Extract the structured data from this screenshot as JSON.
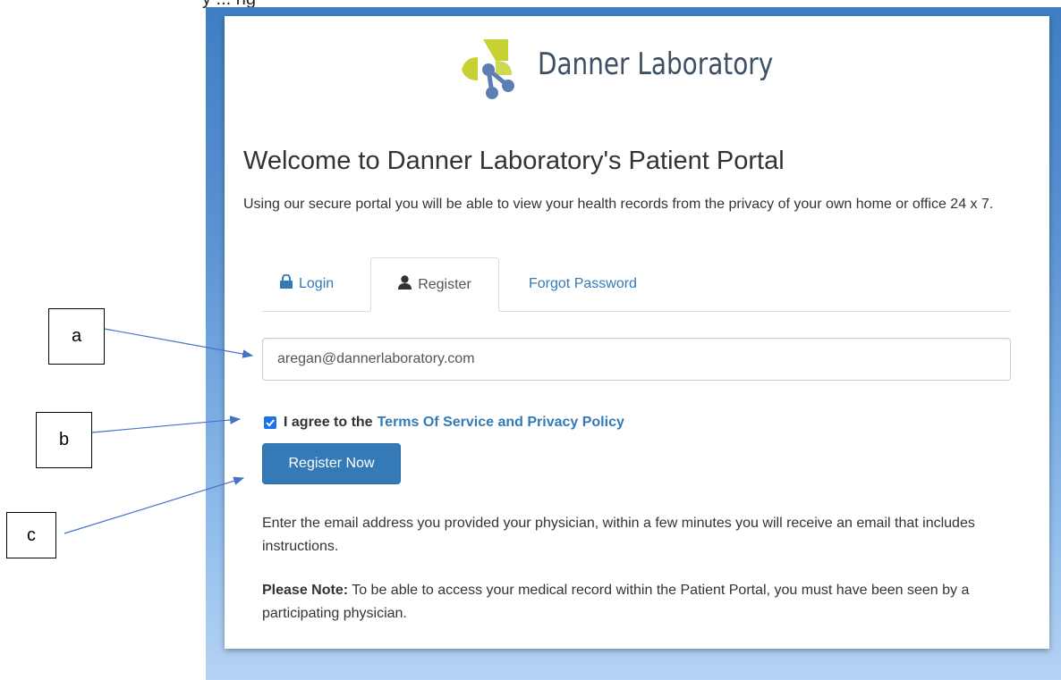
{
  "caption": "y ... ng",
  "brand": {
    "name": "Danner Laboratory",
    "colors": {
      "leaf": "#c6d133",
      "dark": "#3d4f63",
      "molecule": "#5b7fb5"
    }
  },
  "page": {
    "title": "Welcome to Danner Laboratory's Patient Portal",
    "subtitle": "Using our secure portal you will be able to view your health records from the privacy of your own home or office 24 x 7."
  },
  "tabs": {
    "login": {
      "label": "Login",
      "icon": "lock-icon"
    },
    "register": {
      "label": "Register",
      "icon": "user-icon",
      "active": true
    },
    "forgot": {
      "label": "Forgot Password"
    }
  },
  "form": {
    "email_value": "aregan@dannerlaboratory.com",
    "agree_text": "I agree to the",
    "agree_link": "Terms Of Service and Privacy Policy",
    "agree_checked": true,
    "submit_label": "Register Now"
  },
  "info": {
    "instructions": "Enter the email address you provided your physician, within a few minutes you will receive an email that includes instructions.",
    "note_label": "Please Note:",
    "note_text": " To be able to access your medical record within the Patient Portal, you must have been seen by a participating physician."
  },
  "callouts": {
    "a": "a",
    "b": "b",
    "c": "c"
  },
  "colors": {
    "link": "#337ab7",
    "button": "#337ab7",
    "checkbox": "#1a73e8",
    "frame_top": "#3f7ec4",
    "frame_bottom": "#b5d3f4"
  }
}
